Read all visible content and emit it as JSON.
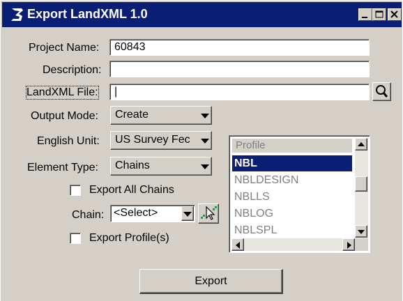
{
  "window": {
    "title": "Export LandXML 1.0",
    "controls": [
      "minimize",
      "maximize",
      "close"
    ]
  },
  "form": {
    "project_name": {
      "label": "Project Name:",
      "value": "60843"
    },
    "description": {
      "label": "Description:",
      "value": ""
    },
    "landxml_file": {
      "label": "LandXML File:",
      "value": "|"
    },
    "output_mode": {
      "label": "Output Mode:",
      "value": "Create"
    },
    "english_unit": {
      "label": "English Unit:",
      "value": "US Survey Feс"
    },
    "element_type": {
      "label": "Element Type:",
      "value": "Chains"
    },
    "export_all_chains": {
      "label": "Export All Chains",
      "checked": false
    },
    "chain": {
      "label": "Chain:",
      "value": "<Select>"
    },
    "export_profiles": {
      "label": "Export Profile(s)",
      "checked": false
    }
  },
  "profile_list": {
    "header": "Profile",
    "items": [
      "NBL",
      "NBLDESIGN",
      "NBLLS",
      "NBLOG",
      "NBLSPL"
    ],
    "selected": "NBL"
  },
  "actions": {
    "export_label": "Export"
  },
  "colors": {
    "titlebar": "#0a1e74",
    "dialog_bg": "#d4d0c8",
    "selection": "#0a1e74"
  },
  "icons": {
    "app": "bentley-b-icon",
    "search": "magnifier-icon",
    "pick": "pointer-pick-icon"
  }
}
